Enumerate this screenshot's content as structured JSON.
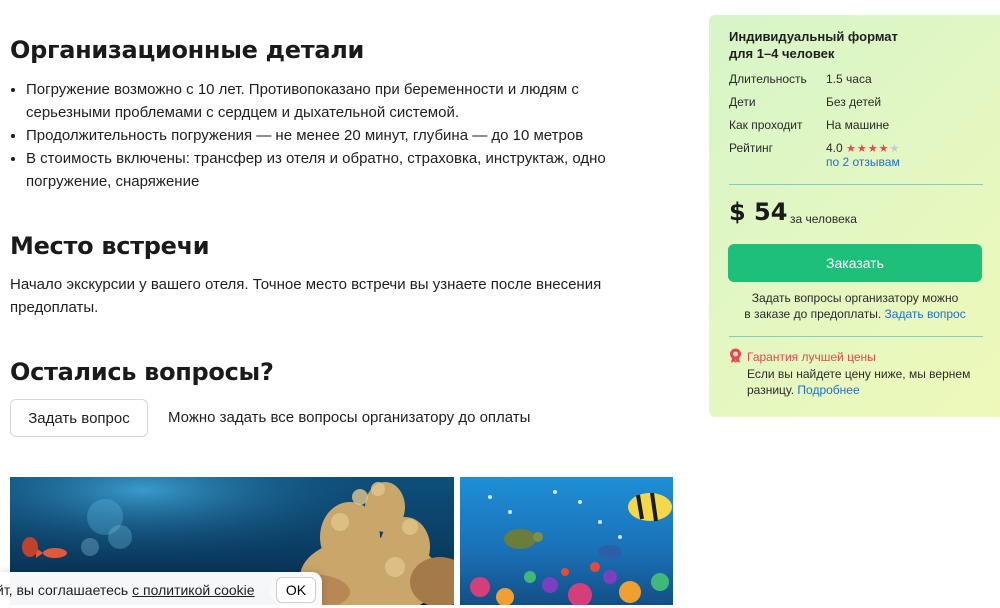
{
  "details": {
    "title": "Организационные детали",
    "items": [
      "Погружение возможно с 10 лет. Противопоказано при беременности и людям с серьезными проблемами с сердцем и дыхательной системой.",
      "Продолжительность погружения — не менее 20 минут, глубина — до 10 метров",
      "В стоимость включены: трансфер из отеля и обратно, страховка, инструктаж, одно погружение, снаряжение"
    ]
  },
  "meeting": {
    "title": "Место встречи",
    "text": "Начало экскурсии у вашего отеля. Точное место встречи вы узнаете после внесения предоплаты."
  },
  "questions": {
    "title": "Остались вопросы?",
    "button_label": "Задать вопрос",
    "hint": "Можно задать все вопросы организатору до оплаты"
  },
  "cookie": {
    "text_prefix": "йт, вы соглашаетесь ",
    "link_text": "с политикой cookie",
    "ok_label": "OK"
  },
  "card": {
    "title_line1": "Индивидуальный формат",
    "title_line2": "для 1–4 человек",
    "rows": [
      {
        "label": "Длительность",
        "value": "1.5 часа"
      },
      {
        "label": "Дети",
        "value": "Без детей"
      },
      {
        "label": "Как проходит",
        "value": "На машине"
      }
    ],
    "rating_label": "Рейтинг",
    "rating_value": "4.0",
    "rating_stars": 4,
    "rating_max": 5,
    "reviews_link": "по 2 отзывам",
    "price": "$ 54",
    "price_unit": "за человека",
    "order_label": "Заказать",
    "ask_note_line1": "Задать вопросы организатору можно",
    "ask_note_line2": "в заказе до предоплаты.",
    "ask_note_link": "Задать вопрос",
    "guarantee_title": "Гарантия лучшей цены",
    "guarantee_text": "Если вы найдете цену ниже, мы вернем разницу.",
    "guarantee_link": "Подробнее"
  },
  "colors": {
    "accent_green": "#1dbf7b",
    "link_blue": "#1f6fd1",
    "guarantee_red": "#e5484d"
  }
}
